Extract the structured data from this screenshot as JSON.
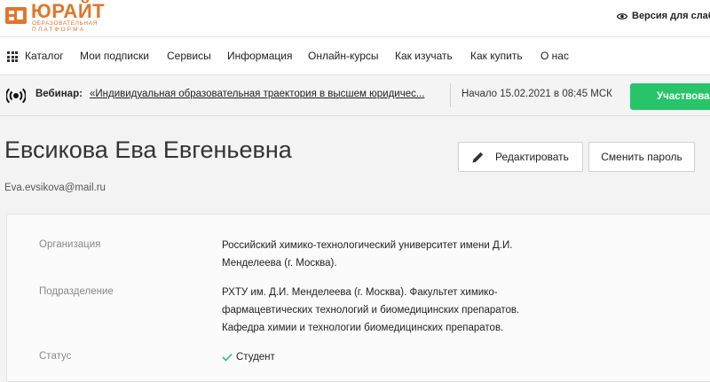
{
  "brand": {
    "name": "ЮРАЙТ",
    "subtitle_line1": "ОБРАЗОВАТЕЛЬНАЯ",
    "subtitle_line2": "ПЛАТФОРМА",
    "accent_color": "#e0762b"
  },
  "header": {
    "accessibility_label": "Версия для слабов",
    "accessibility_icon": "eye-icon"
  },
  "nav": {
    "catalog_icon": "grid-icon",
    "items": [
      {
        "label": "Каталог"
      },
      {
        "label": "Мои подписки"
      },
      {
        "label": "Сервисы"
      },
      {
        "label": "Информация"
      },
      {
        "label": "Онлайн-курсы"
      },
      {
        "label": "Как изучать"
      },
      {
        "label": "Как купить"
      },
      {
        "label": "О нас"
      }
    ]
  },
  "webinar": {
    "icon": "broadcast-icon",
    "label": "Вебинар:",
    "title": "«Индивидуальная образовательная траектория в высшем юридичес...",
    "date": "Начало 15.02.2021 в 08:45 МСК",
    "join_label": "Участвоват",
    "join_color": "#27c46a"
  },
  "profile": {
    "name": "Евсикова Ева Евгеньевна",
    "email": "Eva.evsikova@mail.ru",
    "edit_label": "Редактировать",
    "edit_icon": "pencil-icon",
    "change_password_label": "Сменить пароль"
  },
  "details": {
    "organization_label": "Организация",
    "organization_lines": [
      "Российский химико-технологический университет имени Д.И.",
      "Менделеева (г. Москва)."
    ],
    "department_label": "Подразделение",
    "department_lines": [
      "РХТУ им. Д.И. Менделеева (г. Москва). Факультет химико-",
      "фармацевтических технологий и биомедицинских препаратов.",
      "Кафедра химии и технологии биомедицинских препаратов."
    ],
    "status_label": "Статус",
    "status_value": "Студент",
    "status_icon": "check-icon"
  }
}
